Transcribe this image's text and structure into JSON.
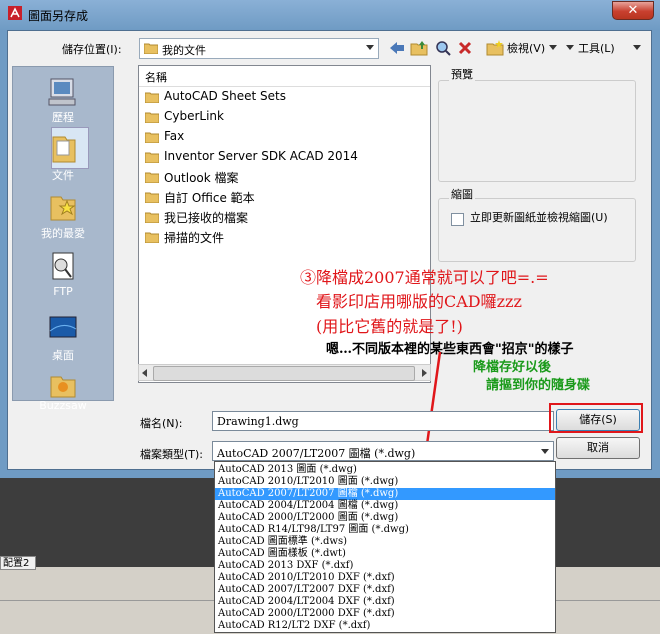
{
  "window": {
    "title": "圖面另存成",
    "close_label": "✕"
  },
  "toolbar": {
    "save_in_label": "儲存位置(I):",
    "save_in_value": "我的文件",
    "views_label": "檢視(V)",
    "tools_label": "工具(L)"
  },
  "places": [
    {
      "label": "歷程",
      "icon": "history-icon"
    },
    {
      "label": "文件",
      "icon": "documents-icon"
    },
    {
      "label": "我的最愛",
      "icon": "favorites-icon"
    },
    {
      "label": "FTP",
      "icon": "ftp-icon"
    },
    {
      "label": "桌面",
      "icon": "desktop-icon"
    },
    {
      "label": "Buzzsaw",
      "icon": "buzzsaw-icon"
    }
  ],
  "filelist": {
    "column_name": "名稱",
    "items": [
      {
        "name": "AutoCAD Sheet Sets"
      },
      {
        "name": "CyberLink"
      },
      {
        "name": "Fax"
      },
      {
        "name": "Inventor Server SDK ACAD 2014"
      },
      {
        "name": "Outlook 檔案"
      },
      {
        "name": "自訂 Office 範本"
      },
      {
        "name": "我已接收的檔案"
      },
      {
        "name": "掃描的文件"
      }
    ]
  },
  "preview": {
    "label": "預覽"
  },
  "options": {
    "group_label": "縮圖",
    "update_thumbnail_label": "立即更新圖紙並檢視縮圖(U)",
    "update_thumbnail_checked": false
  },
  "file_name": {
    "label": "檔名(N):",
    "value": "Drawing1.dwg"
  },
  "file_type": {
    "label": "檔案類型(T):",
    "value": "AutoCAD 2007/LT2007 圖檔 (*.dwg)",
    "options": [
      "AutoCAD 2013 圖面 (*.dwg)",
      "AutoCAD 2010/LT2010 圖面 (*.dwg)",
      "AutoCAD 2007/LT2007 圖檔 (*.dwg)",
      "AutoCAD 2004/LT2004 圖檔 (*.dwg)",
      "AutoCAD 2000/LT2000 圖面 (*.dwg)",
      "AutoCAD R14/LT98/LT97 圖面 (*.dwg)",
      "AutoCAD 圖面標準 (*.dws)",
      "AutoCAD 圖面樣板 (*.dwt)",
      "AutoCAD 2013 DXF (*.dxf)",
      "AutoCAD 2010/LT2010 DXF (*.dxf)",
      "AutoCAD 2007/LT2007 DXF (*.dxf)",
      "AutoCAD 2004/LT2004 DXF (*.dxf)",
      "AutoCAD 2000/LT2000 DXF (*.dxf)",
      "AutoCAD R12/LT2 DXF (*.dxf)"
    ],
    "selected_index": 2
  },
  "buttons": {
    "save": "儲存(S)",
    "cancel": "取消"
  },
  "background_app": {
    "layout_tab": "配置2"
  },
  "annotations": {
    "line1": "③降檔成2007通常就可以了吧=.=",
    "line2": "看影印店用哪版的CAD囉zzz",
    "line3": "(用比它舊的就是了!)",
    "line4": "嗯…不同版本裡的某些東西會\"招京\"的樣子",
    "line5": "降檔存好以後",
    "line6": "請摳到你的隨身碟"
  },
  "colors": {
    "annotation_red": "#e0161a",
    "annotation_green": "#1a9a1a",
    "selection_blue": "#3399ff",
    "titlebar_blue": "#6f9bc4"
  }
}
